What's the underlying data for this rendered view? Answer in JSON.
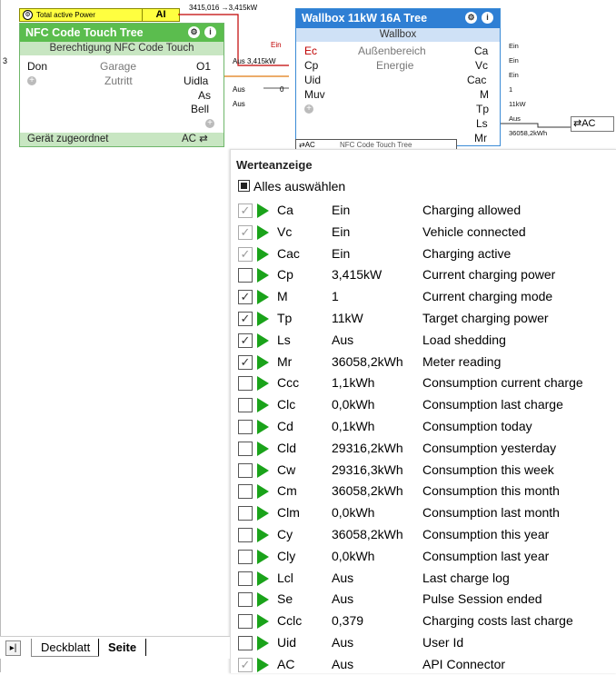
{
  "canvas": {
    "input": {
      "label": "Total active Power",
      "type": "AI",
      "wire_value": "3415,016 →3,415kW"
    },
    "nfc_block": {
      "title": "NFC Code Touch Tree",
      "subtitle": "Berechtigung NFC Code Touch",
      "left_input_num": "3",
      "inputs": [
        {
          "name": "Don",
          "desc": "Garage"
        },
        {
          "name": "",
          "desc": "Zutritt"
        }
      ],
      "outputs": [
        "O1",
        "Uidla",
        "As",
        "Bell"
      ],
      "output_values": [
        "Aus 3,415kW",
        "",
        "Aus",
        "Aus"
      ],
      "footer_left": "Gerät zugeordnet",
      "footer_right": "AC ⇄",
      "uid_input_value": "0"
    },
    "wallbox_block": {
      "title": "Wallbox 11kW 16A Tree",
      "subtitle": "Wallbox",
      "ec_value": "Ein",
      "inputs": [
        {
          "name": "Ec",
          "desc": "Außenbereich"
        },
        {
          "name": "Cp",
          "desc": "Energie"
        },
        {
          "name": "Uid",
          "desc": ""
        },
        {
          "name": "Muv",
          "desc": ""
        }
      ],
      "outputs": [
        "Ca",
        "Vc",
        "Cac",
        "M",
        "Tp",
        "Ls",
        "Mr"
      ],
      "output_values": [
        "Ein",
        "Ein",
        "Ein",
        "1",
        "11kW",
        "Aus",
        "36058,2kWh"
      ]
    },
    "ac_box": "⇄AC",
    "hidden_block": {
      "left": "⇄AC",
      "title": "NFC Code Touch Tree"
    }
  },
  "popup": {
    "title": "Werteanzeige",
    "select_all": "Alles auswählen",
    "rows": [
      {
        "abbr": "Ca",
        "value": "Ein",
        "desc": "Charging allowed",
        "checked": true,
        "disabled": true
      },
      {
        "abbr": "Vc",
        "value": "Ein",
        "desc": "Vehicle connected",
        "checked": true,
        "disabled": true
      },
      {
        "abbr": "Cac",
        "value": "Ein",
        "desc": "Charging active",
        "checked": true,
        "disabled": true
      },
      {
        "abbr": "Cp",
        "value": "3,415kW",
        "desc": "Current charging power",
        "checked": false,
        "disabled": false
      },
      {
        "abbr": "M",
        "value": "1",
        "desc": "Current charging mode",
        "checked": true,
        "disabled": false
      },
      {
        "abbr": "Tp",
        "value": "11kW",
        "desc": "Target charging power",
        "checked": true,
        "disabled": false
      },
      {
        "abbr": "Ls",
        "value": "Aus",
        "desc": "Load shedding",
        "checked": true,
        "disabled": false
      },
      {
        "abbr": "Mr",
        "value": "36058,2kWh",
        "desc": "Meter reading",
        "checked": true,
        "disabled": false
      },
      {
        "abbr": "Ccc",
        "value": "1,1kWh",
        "desc": "Consumption current charge",
        "checked": false,
        "disabled": false
      },
      {
        "abbr": "Clc",
        "value": "0,0kWh",
        "desc": "Consumption last charge",
        "checked": false,
        "disabled": false
      },
      {
        "abbr": "Cd",
        "value": "0,1kWh",
        "desc": "Consumption today",
        "checked": false,
        "disabled": false
      },
      {
        "abbr": "Cld",
        "value": "29316,2kWh",
        "desc": "Consumption yesterday",
        "checked": false,
        "disabled": false
      },
      {
        "abbr": "Cw",
        "value": "29316,3kWh",
        "desc": "Consumption this week",
        "checked": false,
        "disabled": false
      },
      {
        "abbr": "Cm",
        "value": "36058,2kWh",
        "desc": "Consumption this month",
        "checked": false,
        "disabled": false
      },
      {
        "abbr": "Clm",
        "value": "0,0kWh",
        "desc": "Consumption last month",
        "checked": false,
        "disabled": false
      },
      {
        "abbr": "Cy",
        "value": "36058,2kWh",
        "desc": "Consumption this year",
        "checked": false,
        "disabled": false
      },
      {
        "abbr": "Cly",
        "value": "0,0kWh",
        "desc": "Consumption last year",
        "checked": false,
        "disabled": false
      },
      {
        "abbr": "Lcl",
        "value": "Aus",
        "desc": "Last charge log",
        "checked": false,
        "disabled": false
      },
      {
        "abbr": "Se",
        "value": "Aus",
        "desc": "Pulse Session ended",
        "checked": false,
        "disabled": false
      },
      {
        "abbr": "Cclc",
        "value": "0,379",
        "desc": "Charging costs last charge",
        "checked": false,
        "disabled": false
      },
      {
        "abbr": "Uid",
        "value": "Aus",
        "desc": "User Id",
        "checked": false,
        "disabled": false
      },
      {
        "abbr": "AC",
        "value": "Aus",
        "desc": "API Connector",
        "checked": true,
        "disabled": true
      }
    ]
  },
  "tabs": {
    "items": [
      "Deckblatt",
      "Seite"
    ],
    "active": "Seite"
  },
  "colors": {
    "nfc_green": "#5bbd4e",
    "wallbox_blue": "#2f7fd4",
    "indicator_green": "#1aa31a",
    "input_yellow": "#ffff40"
  }
}
